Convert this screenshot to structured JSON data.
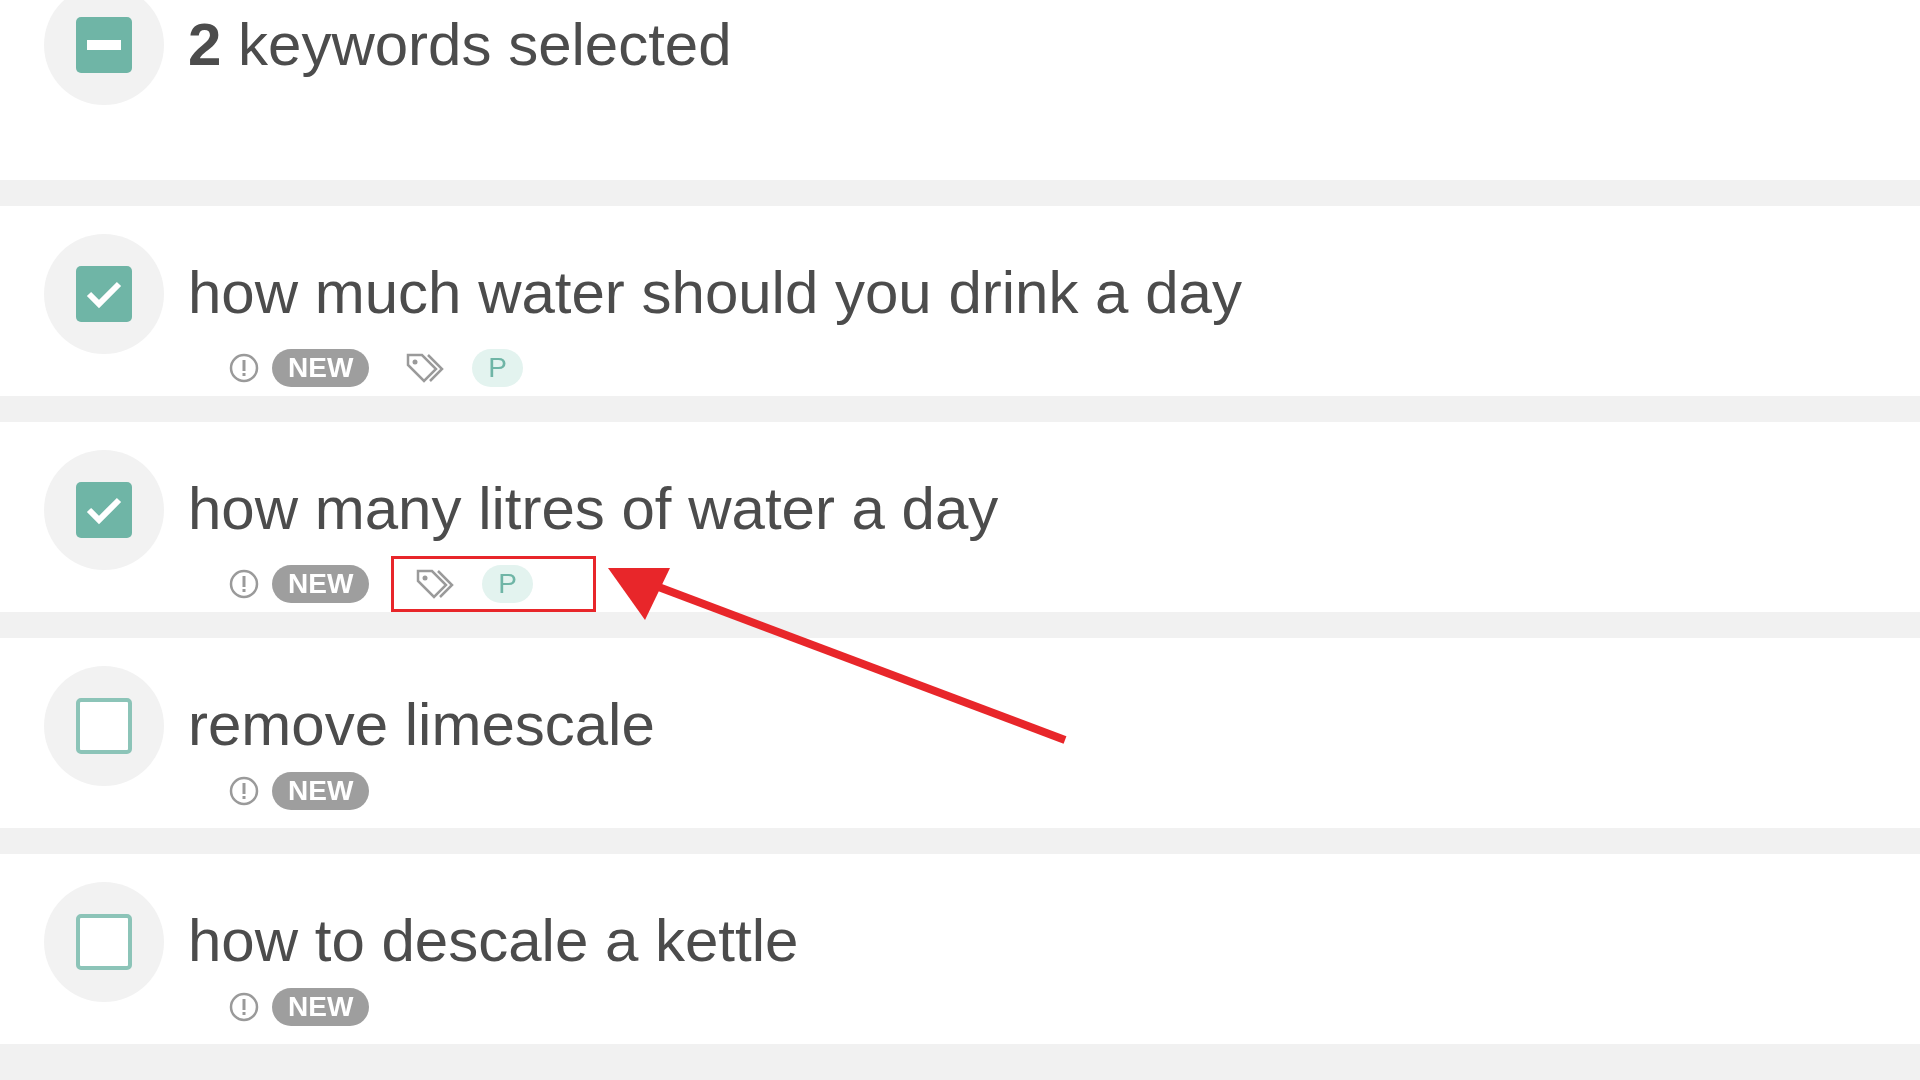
{
  "header": {
    "checked": true,
    "partial": true,
    "count": "2",
    "label": "keywords selected"
  },
  "keywords": [
    {
      "text": "how much water should you drink a day",
      "checked": true,
      "badge": "NEW",
      "tags": [
        "P"
      ]
    },
    {
      "text": "how many litres of water a day",
      "checked": true,
      "badge": "NEW",
      "tags": [
        "P"
      ],
      "annotated": true
    },
    {
      "text": "remove limescale",
      "checked": false,
      "badge": "NEW"
    },
    {
      "text": "how to descale a kettle",
      "checked": false,
      "badge": "NEW"
    }
  ]
}
